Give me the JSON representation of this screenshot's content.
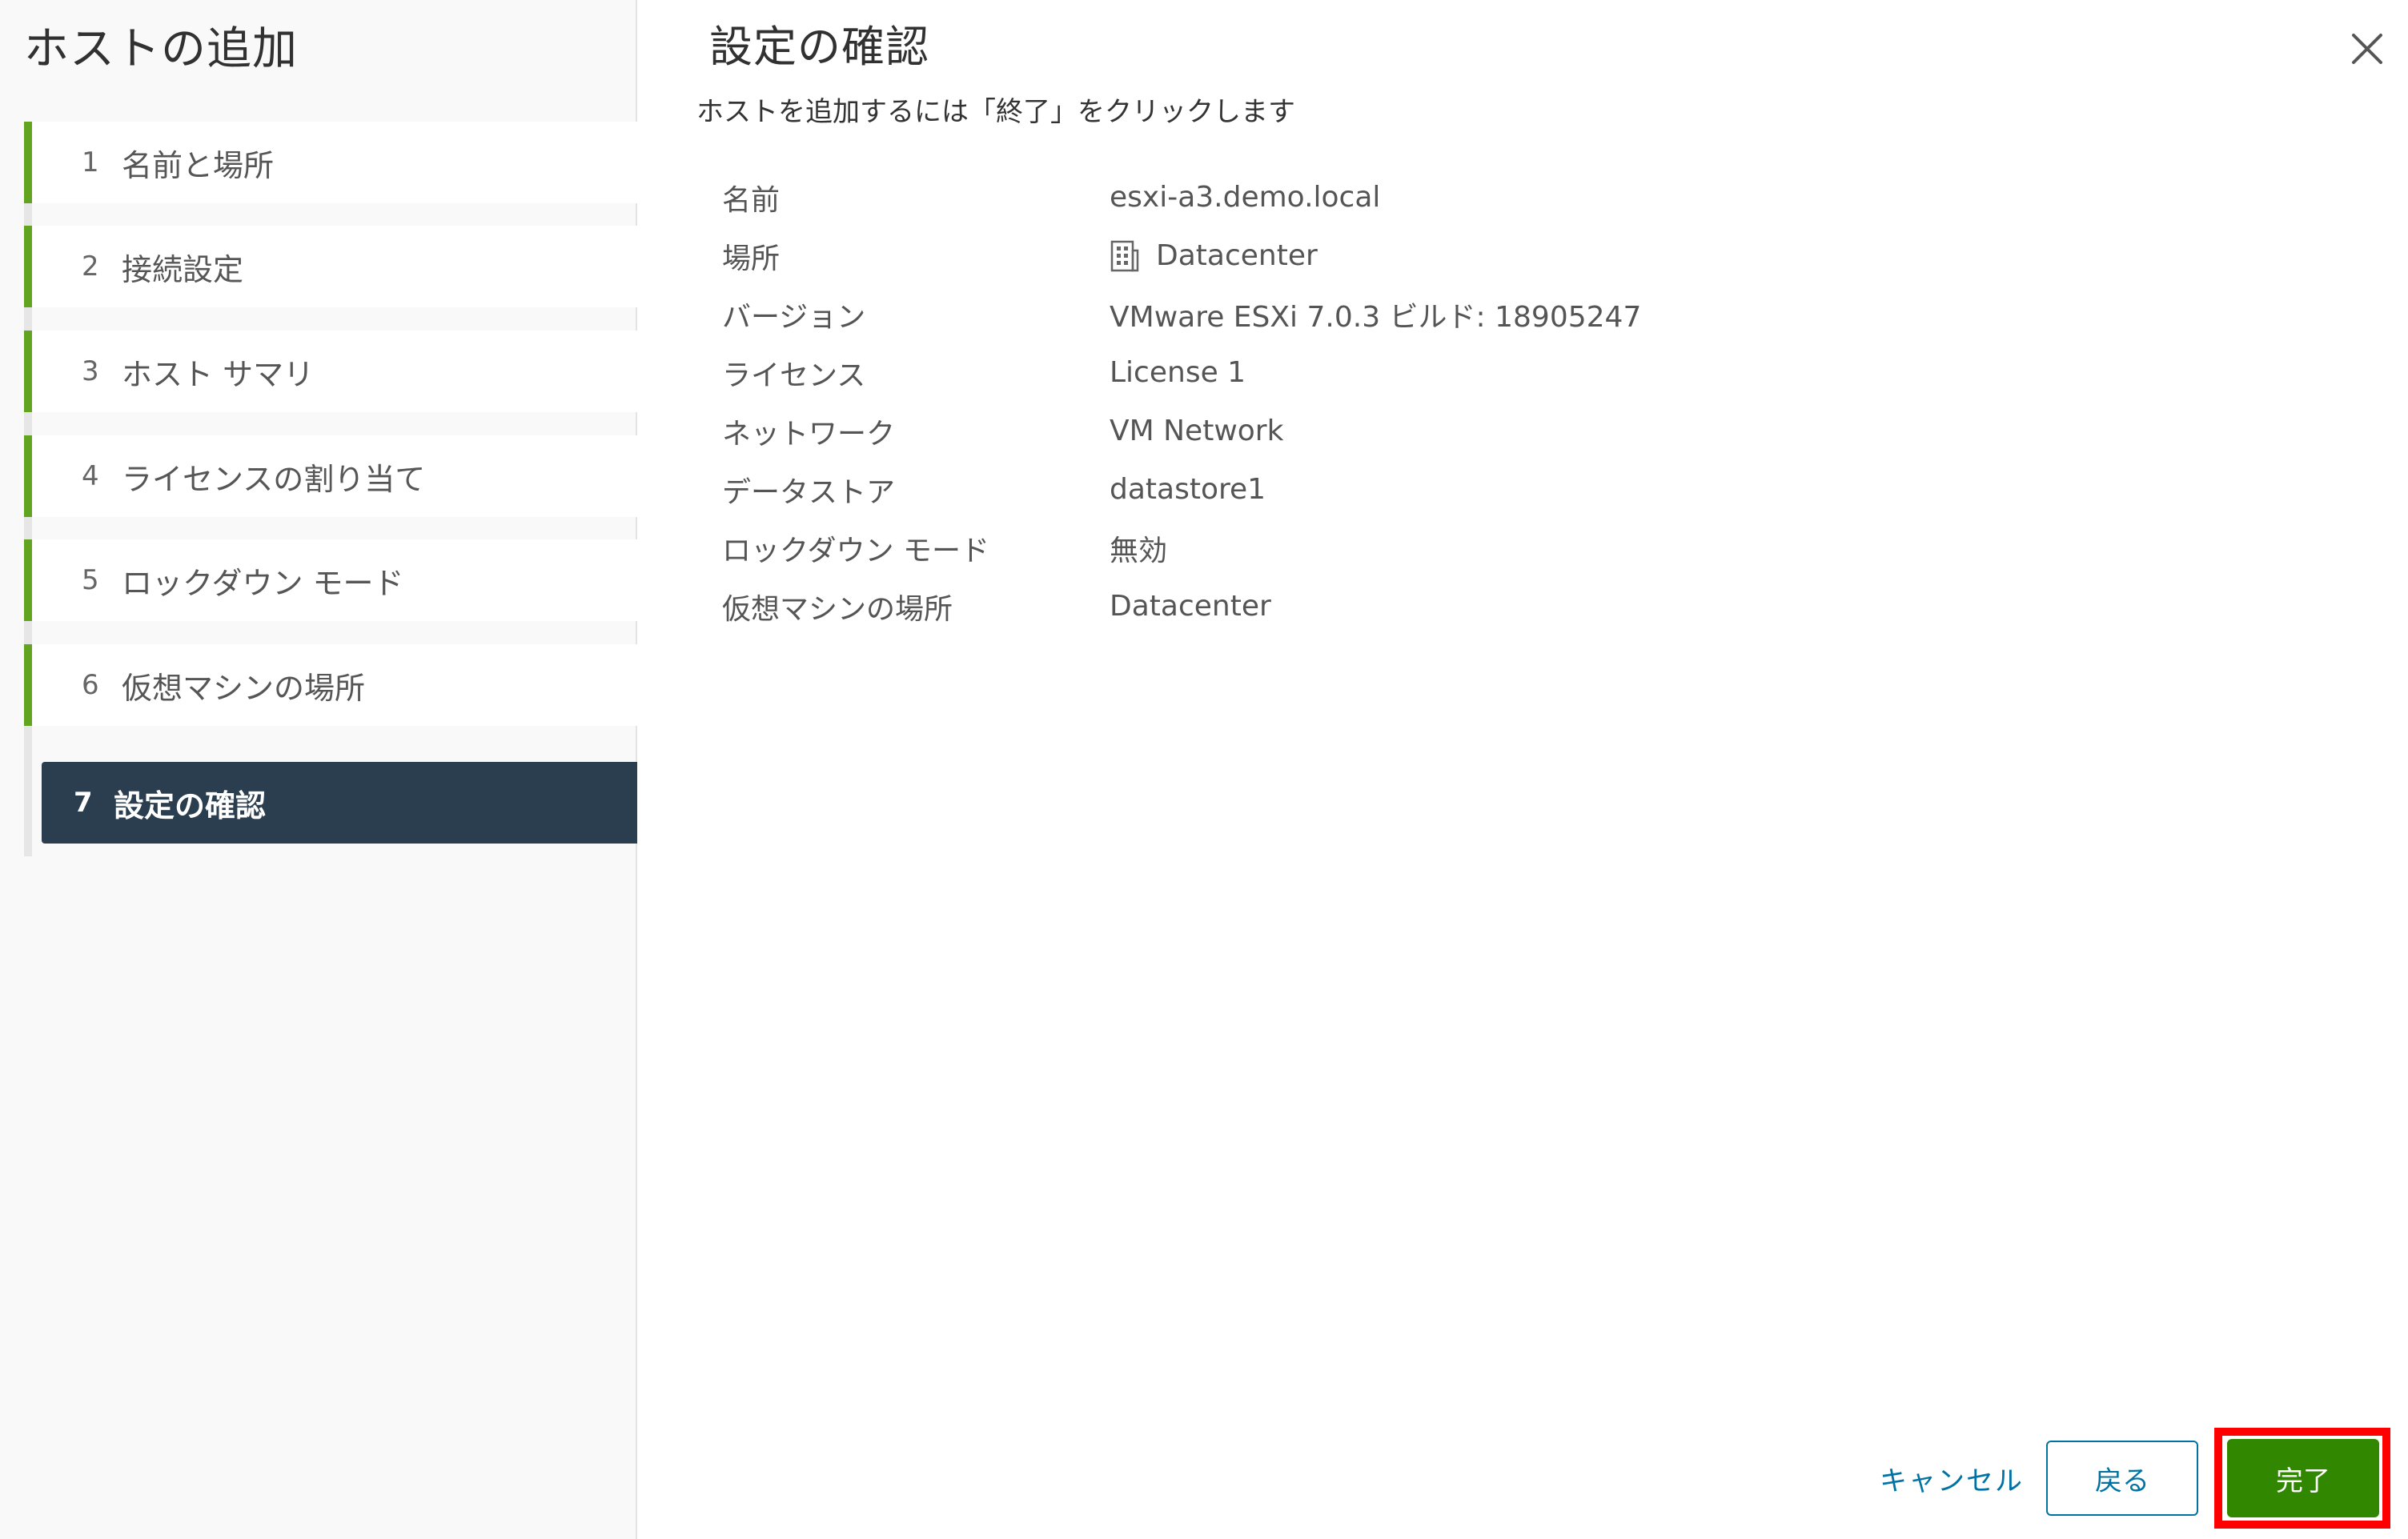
{
  "wizard": {
    "title": "ホストの追加"
  },
  "steps": [
    {
      "num": "1",
      "label": "名前と場所"
    },
    {
      "num": "2",
      "label": "接続設定"
    },
    {
      "num": "3",
      "label": "ホスト サマリ"
    },
    {
      "num": "4",
      "label": "ライセンスの割り当て"
    },
    {
      "num": "5",
      "label": "ロックダウン モード"
    },
    {
      "num": "6",
      "label": "仮想マシンの場所"
    },
    {
      "num": "7",
      "label": "設定の確認"
    }
  ],
  "main": {
    "title": "設定の確認",
    "instructions": "ホストを追加するには「終了」をクリックします",
    "summary": [
      {
        "label": "名前",
        "value": "esxi-a3.demo.local"
      },
      {
        "label": "場所",
        "value": "Datacenter",
        "icon": "datacenter-icon"
      },
      {
        "label": "バージョン",
        "value": "VMware ESXi 7.0.3 ビルド: 18905247"
      },
      {
        "label": "ライセンス",
        "value": "License 1"
      },
      {
        "label": "ネットワーク",
        "value": "VM Network"
      },
      {
        "label": "データストア",
        "value": "datastore1"
      },
      {
        "label": "ロックダウン モード",
        "value": "無効"
      },
      {
        "label": "仮想マシンの場所",
        "value": "Datacenter"
      }
    ]
  },
  "footer": {
    "cancel_label": "キャンセル",
    "back_label": "戻る",
    "finish_label": "完了"
  },
  "colors": {
    "step_complete_bar": "#62a420",
    "step_active_bg": "#2b3e50",
    "link_blue": "#0072a3",
    "finish_green": "#318700",
    "highlight_red": "#ff0000"
  }
}
